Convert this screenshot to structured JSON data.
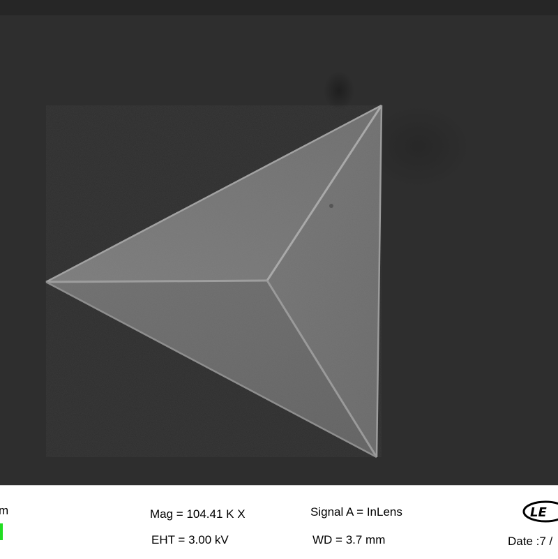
{
  "image": {
    "subject": "pyramid-shaped particle",
    "background_color": "#2e2e2e",
    "top_strip_color": "#262626"
  },
  "info_bar": {
    "scale_unit": "m",
    "scale_bar_color": "#22dd22",
    "mag": "Mag = 104.41 K X",
    "eht": "EHT =  3.00 kV",
    "signal": "Signal A = InLens",
    "wd": "WD =  3.7 mm",
    "date": "Date :7 /",
    "logo_text": "LE"
  }
}
